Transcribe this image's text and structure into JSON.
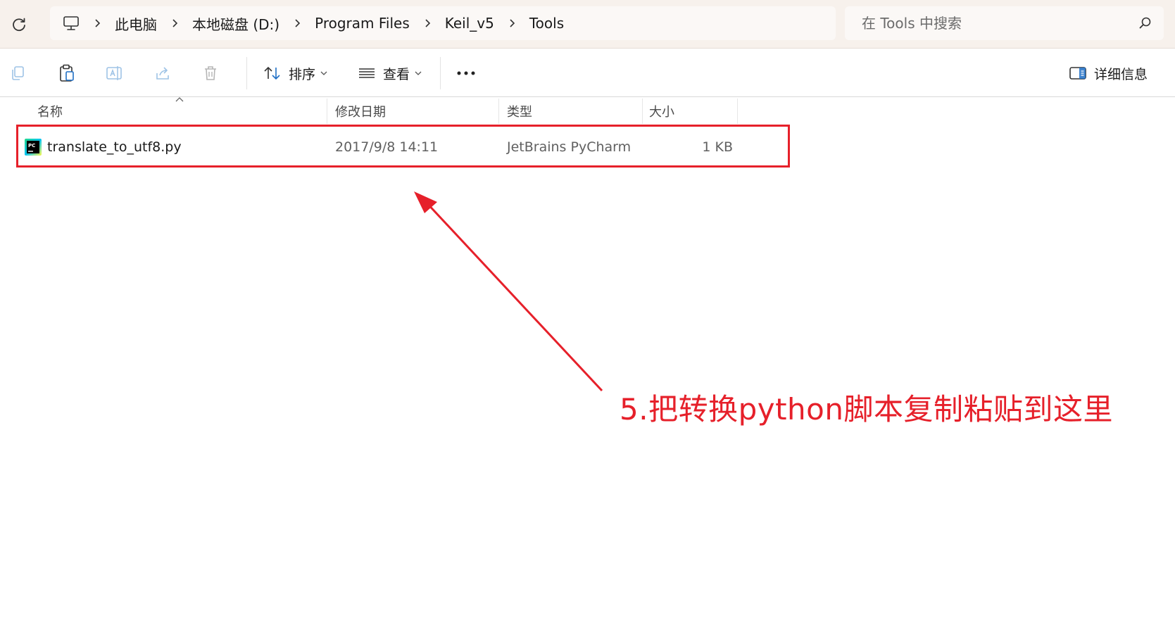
{
  "breadcrumb": {
    "items": [
      "此电脑",
      "本地磁盘 (D:)",
      "Program Files",
      "Keil_v5",
      "Tools"
    ]
  },
  "search": {
    "placeholder": "在 Tools 中搜索"
  },
  "toolbar": {
    "sort_label": "排序",
    "view_label": "查看",
    "details_label": "详细信息"
  },
  "columns": {
    "name": "名称",
    "modified": "修改日期",
    "type": "类型",
    "size": "大小"
  },
  "files": [
    {
      "name": "translate_to_utf8.py",
      "modified": "2017/9/8 14:11",
      "type": "JetBrains PyCharm",
      "size": "1 KB"
    }
  ],
  "annotation": {
    "text": "5.把转换python脚本复制粘贴到这里"
  },
  "colors": {
    "annotation": "#e6202a",
    "titlebar": "#f7f1ec"
  },
  "icons": [
    "refresh-icon",
    "computer-icon",
    "chevron-right-icon",
    "search-icon",
    "copy-icon",
    "paste-icon",
    "rename-icon",
    "share-icon",
    "delete-icon",
    "sort-icon",
    "view-icon",
    "more-icon",
    "details-pane-icon",
    "pycharm-file-icon"
  ]
}
